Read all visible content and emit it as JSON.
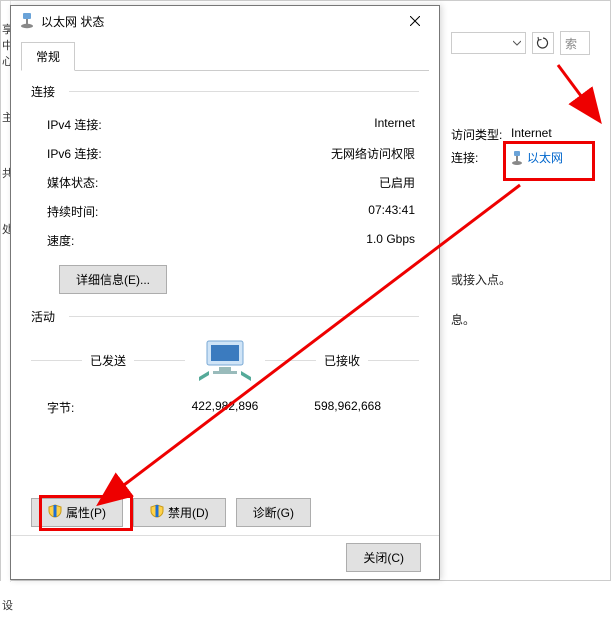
{
  "bg": {
    "search_placeholder": "搜索控",
    "access_type_label": "访问类型:",
    "access_type_val": "Internet",
    "conn_label": "连接:",
    "conn_link": "以太网",
    "text1": "或接入点。",
    "text2": "息。",
    "left_items": [
      "享中心",
      "主",
      "共",
      "处",
      "",
      "设"
    ]
  },
  "dialog": {
    "title": "以太网 状态",
    "tab_general": "常规",
    "conn_section": "连接",
    "rows": [
      {
        "label": "IPv4 连接:",
        "val": "Internet"
      },
      {
        "label": "IPv6 连接:",
        "val": "无网络访问权限"
      },
      {
        "label": "媒体状态:",
        "val": "已启用"
      },
      {
        "label": "持续时间:",
        "val": "07:43:41"
      },
      {
        "label": "速度:",
        "val": "1.0 Gbps"
      }
    ],
    "details_btn": "详细信息(E)...",
    "activity_section": "活动",
    "sent_label": "已发送",
    "recv_label": "已接收",
    "bytes_label": "字节:",
    "sent_bytes": "422,982,896",
    "recv_bytes": "598,962,668",
    "props_btn": "属性(P)",
    "disable_btn": "禁用(D)",
    "diag_btn": "诊断(G)",
    "close_btn": "关闭(C)"
  }
}
